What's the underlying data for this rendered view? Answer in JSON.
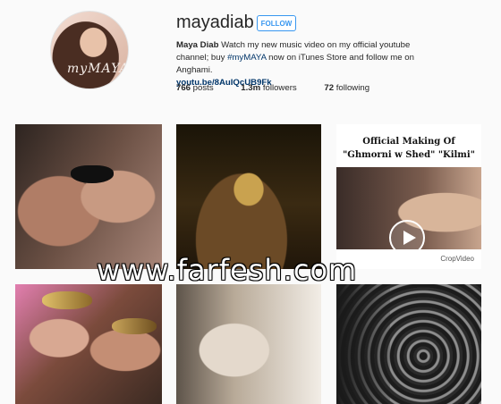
{
  "profile": {
    "username": "mayadiab",
    "follow_label": "FOLLOW",
    "avatar_signature": "myMAYA",
    "bio": {
      "name": "Maya Diab",
      "text_1": " Watch my new music video on my official youtube channel; buy ",
      "hashtag": "#myMAYA",
      "text_2": " now on iTunes Store and follow me on Anghami.",
      "link": "youtu.be/8AuIQcUB9Fk"
    },
    "stats": {
      "posts_count": "766",
      "posts_label": " posts",
      "followers_count": "1.3m",
      "followers_label": " followers",
      "following_count": "72",
      "following_label": " following"
    }
  },
  "posts": {
    "video_title_line1": "Official Making Of",
    "video_title_line2": "\"Ghmorni w Shed\" \"Kilmi\"",
    "video_watermark": "CropVideo"
  },
  "watermark": "www.farfesh.com",
  "icons": [
    "play-icon"
  ]
}
